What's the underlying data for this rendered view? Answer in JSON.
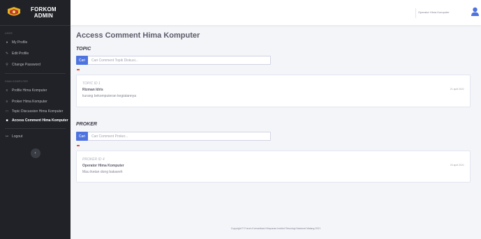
{
  "sidebar": {
    "brand": {
      "line1": "FORKOM",
      "line2": "ADMIN"
    },
    "section_account": "USER",
    "account_items": [
      {
        "label": "My Profile",
        "icon": "user-icon"
      },
      {
        "label": "Edit Profile",
        "icon": "user-edit-icon"
      },
      {
        "label": "Change Password",
        "icon": "key-icon"
      }
    ],
    "section_hima": "HIMA KOMPUTER",
    "hima_items": [
      {
        "label": "Profile Hima Komputer",
        "icon": "list-icon"
      },
      {
        "label": "Proker Hima Komputer",
        "icon": "list-icon"
      },
      {
        "label": "Topic Discussion Hima Komputer",
        "icon": "comments-icon"
      },
      {
        "label": "Access Comment Hima Komputer",
        "icon": "comments-icon",
        "active": true
      }
    ],
    "logout_label": "Logout",
    "toggle_icon": "chevron-left-icon"
  },
  "topbar": {
    "user_name": "Operator Hima Komputer",
    "avatar_color": "#4e73df"
  },
  "main": {
    "title": "Access Comment Hima Komputer",
    "topic": {
      "label": "TOPIC",
      "button": "Cari",
      "placeholder": "Cari Comment Topik Diskusi...",
      "card": {
        "id": "TOPIC ID 1",
        "name": "Rizman Idris",
        "desc": "kurang bekomputeran kegiatannya",
        "date": "21 april 2021"
      }
    },
    "proker": {
      "label": "PROKER",
      "button": "Cari",
      "placeholder": "Cari Comment Proker...",
      "card": {
        "id": "PROKER ID 4",
        "name": "Operator Hima Komputer",
        "desc": "Mau iketan dong bakaeeh",
        "date": "20 april 2021"
      }
    }
  },
  "footer": "Copyright © Forum Komunikasi Himpunan Institut Teknologi Nasional Malang 2021",
  "colors": {
    "primary": "#4e73df",
    "accent": "#e74a3b",
    "sidebar": "#202227"
  }
}
